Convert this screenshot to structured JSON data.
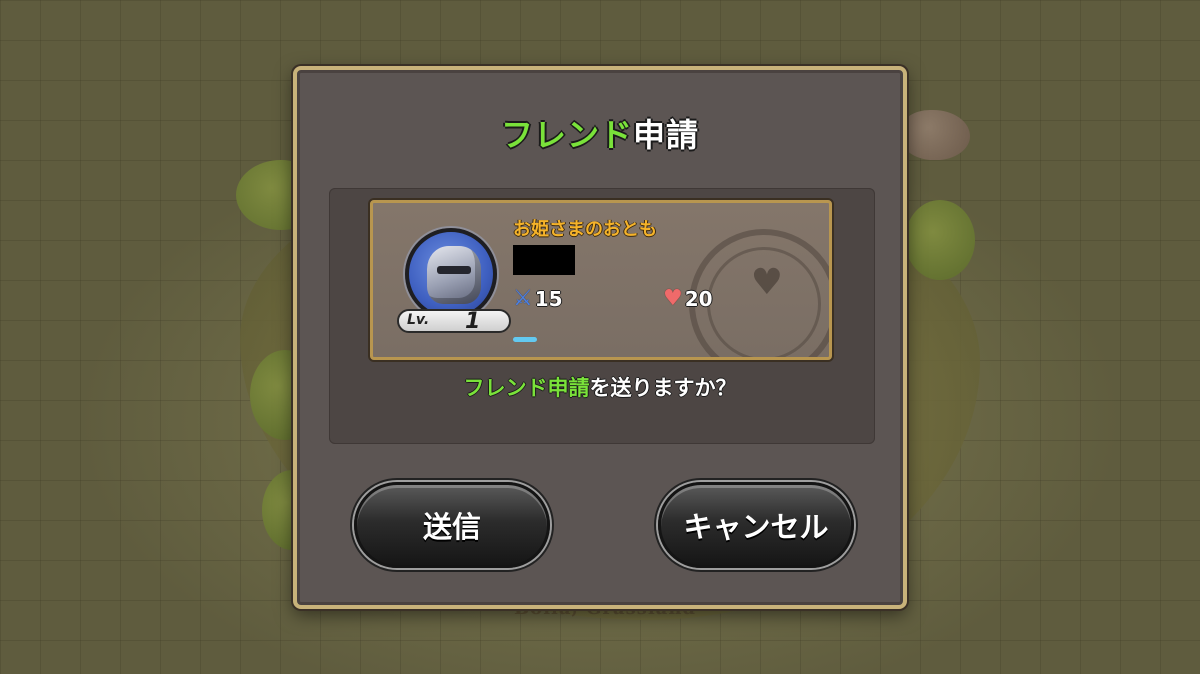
{
  "background": {
    "caption": "Bolla, Grassland"
  },
  "dialog": {
    "title_green": "フレンド",
    "title_white": "申請",
    "player": {
      "name": "お姫さまのおとも",
      "level_label": "Lv.",
      "level": "1",
      "attack": "15",
      "hp": "20",
      "exp_progress": 0.2
    },
    "prompt_green": "フレンド申請",
    "prompt_white": "を送りますか？",
    "buttons": {
      "send_label": "送信",
      "cancel_label": "キャンセル"
    }
  },
  "icons": {
    "attack": "sword-icon",
    "hp": "heart-icon",
    "emblem": "crest-emblem-icon"
  },
  "colors": {
    "accent_green": "#7ae23a",
    "name_orange": "#f5b32a",
    "card_border": "#b8964f"
  }
}
